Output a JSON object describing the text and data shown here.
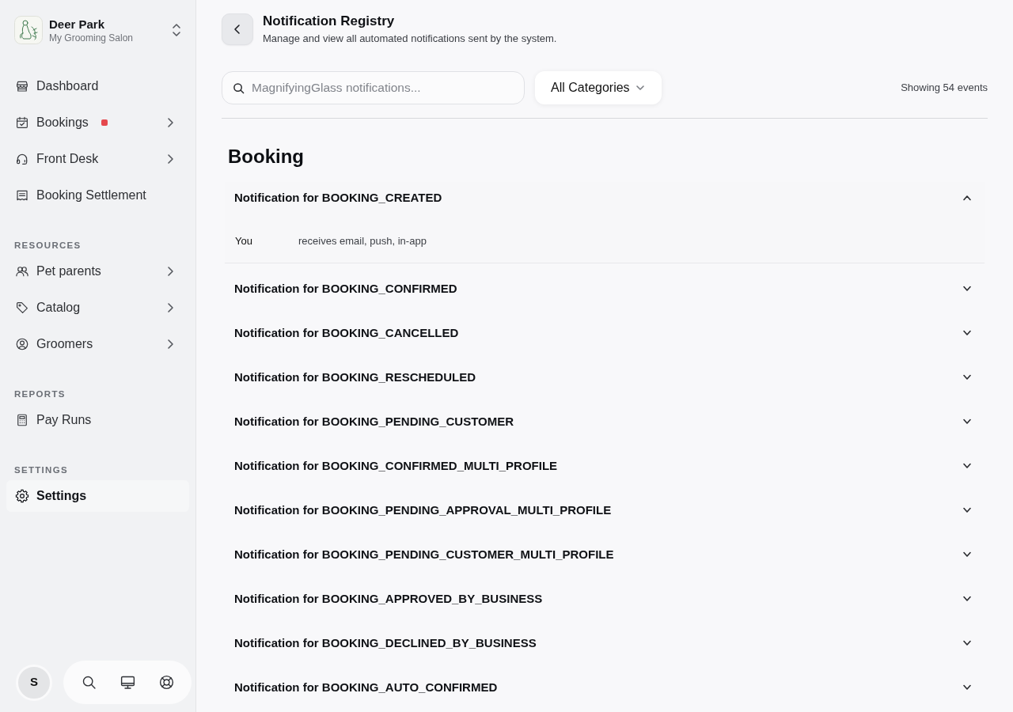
{
  "sidebar": {
    "business": {
      "name": "Deer Park",
      "subtitle": "My Grooming Salon"
    },
    "sections": [
      {
        "items": [
          {
            "label": "Dashboard",
            "selected": false,
            "notification_dot": false,
            "has_submenu": false
          },
          {
            "label": "Bookings",
            "selected": false,
            "notification_dot": true,
            "has_submenu": true
          },
          {
            "label": "Front Desk",
            "selected": false,
            "notification_dot": false,
            "has_submenu": true
          },
          {
            "label": "Booking Settlement",
            "selected": false,
            "notification_dot": false,
            "has_submenu": false
          }
        ]
      },
      {
        "title": "RESOURCES",
        "items": [
          {
            "label": "Pet parents",
            "selected": false,
            "notification_dot": false,
            "has_submenu": true
          },
          {
            "label": "Catalog",
            "selected": false,
            "notification_dot": false,
            "has_submenu": true
          },
          {
            "label": "Groomers",
            "selected": false,
            "notification_dot": false,
            "has_submenu": true
          }
        ]
      },
      {
        "title": "REPORTS",
        "items": [
          {
            "label": "Pay Runs",
            "selected": false,
            "notification_dot": false,
            "has_submenu": false
          }
        ]
      },
      {
        "title": "SETTINGS",
        "items": [
          {
            "label": "Settings",
            "selected": true,
            "notification_dot": false,
            "has_submenu": false
          }
        ]
      }
    ],
    "user": {
      "initial": "S"
    }
  },
  "header": {
    "title": "Notification Registry",
    "subtitle": "Manage and view all automated notifications sent by the system."
  },
  "toolbar": {
    "search": {
      "placeholder": "MagnifyingGlass notifications..."
    },
    "category_filter": "All Categories",
    "count": "Showing 54 events"
  },
  "groups": [
    {
      "title": "Booking",
      "notifications": [
        {
          "title": "Notification for BOOKING_CREATED",
          "expanded": true,
          "recipients": [
            {
              "who": "You",
              "channels": "receives email, push, in-app"
            }
          ]
        },
        {
          "title": "Notification for BOOKING_CONFIRMED",
          "expanded": false
        },
        {
          "title": "Notification for BOOKING_CANCELLED",
          "expanded": false
        },
        {
          "title": "Notification for BOOKING_RESCHEDULED",
          "expanded": false
        },
        {
          "title": "Notification for BOOKING_PENDING_CUSTOMER",
          "expanded": false
        },
        {
          "title": "Notification for BOOKING_CONFIRMED_MULTI_PROFILE",
          "expanded": false
        },
        {
          "title": "Notification for BOOKING_PENDING_APPROVAL_MULTI_PROFILE",
          "expanded": false
        },
        {
          "title": "Notification for BOOKING_PENDING_CUSTOMER_MULTI_PROFILE",
          "expanded": false
        },
        {
          "title": "Notification for BOOKING_APPROVED_BY_BUSINESS",
          "expanded": false
        },
        {
          "title": "Notification for BOOKING_DECLINED_BY_BUSINESS",
          "expanded": false
        },
        {
          "title": "Notification for BOOKING_AUTO_CONFIRMED",
          "expanded": false
        }
      ]
    }
  ]
}
